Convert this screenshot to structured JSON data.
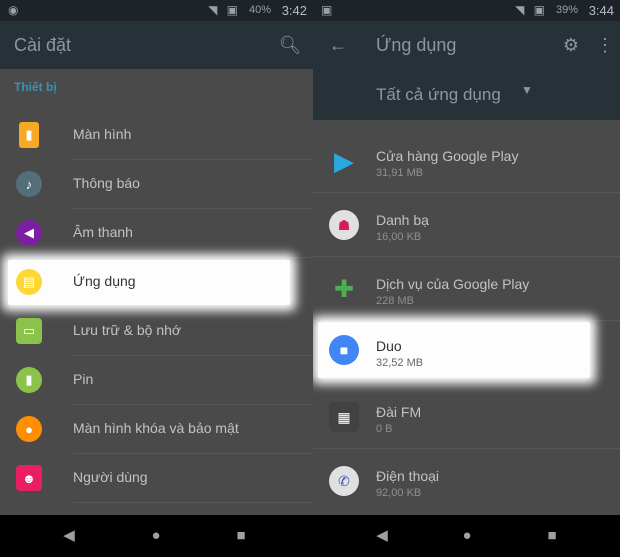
{
  "left": {
    "status": {
      "battery": "40%",
      "time": "3:42"
    },
    "appbar": {
      "title": "Cài đặt",
      "search_icon": "search-icon"
    },
    "section": "Thiết bị",
    "items": [
      {
        "label": "Màn hình",
        "icon": "display-icon",
        "color": "#f9a825"
      },
      {
        "label": "Thông báo",
        "icon": "bell-icon",
        "color": "#546e7a"
      },
      {
        "label": "Âm thanh",
        "icon": "speaker-icon",
        "color": "#7b1fa2"
      },
      {
        "label": "Ứng dụng",
        "icon": "apps-icon",
        "color": "#fdd835"
      },
      {
        "label": "Lưu trữ & bộ nhớ",
        "icon": "storage-icon",
        "color": "#8bc34a"
      },
      {
        "label": "Pin",
        "icon": "battery-icon",
        "color": "#8bc34a"
      },
      {
        "label": "Màn hình khóa và bảo mật",
        "icon": "lock-icon",
        "color": "#ff8f00"
      },
      {
        "label": "Người dùng",
        "icon": "users-icon",
        "color": "#e91e63"
      }
    ]
  },
  "right": {
    "status": {
      "battery": "39%",
      "time": "3:44"
    },
    "appbar": {
      "title": "Ứng dụng"
    },
    "spinner": {
      "selected": "Tất cả ứng dụng"
    },
    "apps": [
      {
        "name": "Cửa hàng Google Play",
        "size": "31,91 MB",
        "icon": "play-store-icon",
        "color": "#2aa8e0"
      },
      {
        "name": "Danh bạ",
        "size": "16,00 KB",
        "icon": "contacts-icon",
        "color": "#d81b60"
      },
      {
        "name": "Dịch vụ của Google Play",
        "size": "228 MB",
        "icon": "play-services-icon",
        "color": "#4caf50"
      },
      {
        "name": "Duo",
        "size": "32,52 MB",
        "icon": "duo-icon",
        "color": "#4285f4"
      },
      {
        "name": "Đài FM",
        "size": "0 B",
        "icon": "radio-icon",
        "color": "#424242"
      },
      {
        "name": "Điện thoại",
        "size": "92,00 KB",
        "icon": "phone-icon",
        "color": "#3f51b5"
      }
    ]
  }
}
